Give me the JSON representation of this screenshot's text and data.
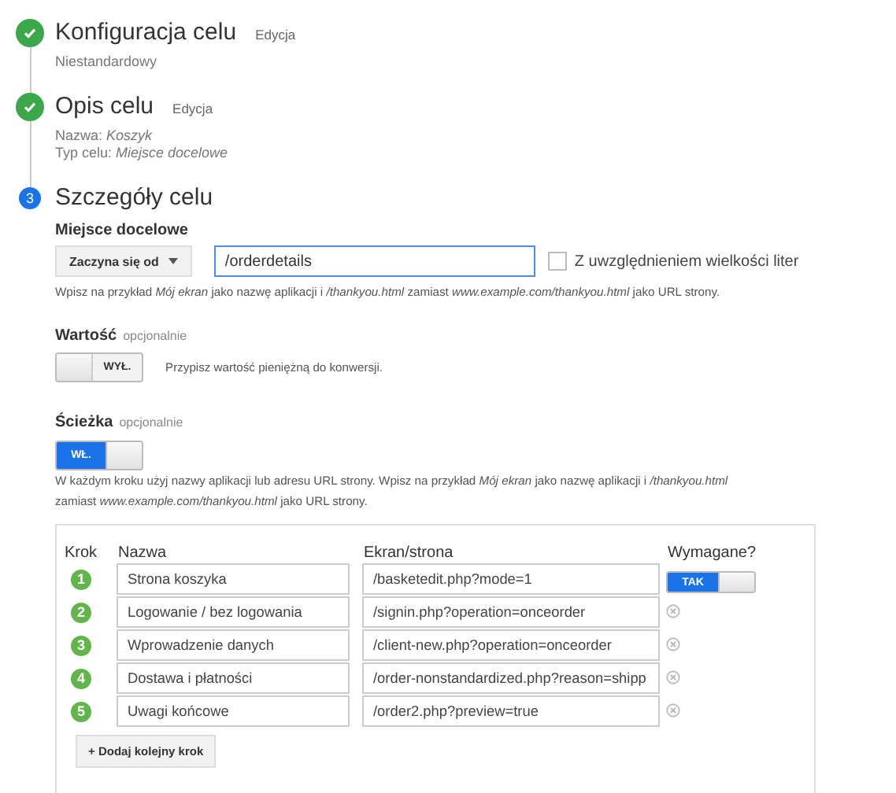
{
  "steps": [
    {
      "title": "Konfiguracja celu",
      "completed": true,
      "edit_link": "Edycja",
      "summary": [
        "Niestandardowy"
      ]
    },
    {
      "title": "Opis celu",
      "completed": true,
      "edit_link": "Edycja",
      "summary": [
        "Nazwa: *Koszyk*",
        "Typ celu: *Miejsce docelowe*"
      ]
    },
    {
      "title": "Szczegóły celu",
      "completed": false,
      "number": "3"
    }
  ],
  "destination": {
    "label": "Miejsce docelowe",
    "match_type": "Zaczyna się od",
    "value": "/orderdetails",
    "case_sensitive": {
      "label": "Z uwzględnieniem wielkości liter",
      "checked": false
    },
    "hint": "Wpisz na przykład *Mój ekran* jako nazwę aplikacji i */thankyou.html* zamiast *www.example.com/thankyou.html* jako URL strony."
  },
  "value": {
    "label": "Wartość",
    "optional": "opcjonalnie",
    "toggle": {
      "on": false,
      "label": "WYŁ."
    },
    "hint": "Przypisz wartość pieniężną do konwersji."
  },
  "funnel": {
    "label": "Ścieżka",
    "optional": "opcjonalnie",
    "toggle": {
      "on": true,
      "label": "WŁ."
    },
    "hint": "W każdym kroku użyj nazwy aplikacji lub adresu URL strony. Wpisz na przykład *Mój ekran* jako nazwę aplikacji i */thankyou.html*\nzamiast *www.example.com/thankyou.html* jako URL strony.",
    "columns": [
      "Krok",
      "Nazwa",
      "Ekran/strona",
      "Wymagane?"
    ],
    "rows": [
      {
        "step": "1",
        "name": "Strona koszyka",
        "screen": "/basketedit.php?mode=1",
        "kind": "required",
        "required": {
          "on": true,
          "label": "TAK"
        }
      },
      {
        "step": "2",
        "name": "Logowanie / bez logowania",
        "screen": "/signin.php?operation=onceorder",
        "kind": "removable"
      },
      {
        "step": "3",
        "name": "Wprowadzenie danych",
        "screen": "/client-new.php?operation=onceorder",
        "kind": "removable"
      },
      {
        "step": "4",
        "name": "Dostawa i płatności",
        "screen": "/order-nonstandardized.php?reason=shipp",
        "kind": "removable"
      },
      {
        "step": "5",
        "name": "Uwagi końcowe",
        "screen": "/order2.php?preview=true",
        "kind": "removable"
      }
    ],
    "add_button": "+ Dodaj kolejny krok"
  }
}
